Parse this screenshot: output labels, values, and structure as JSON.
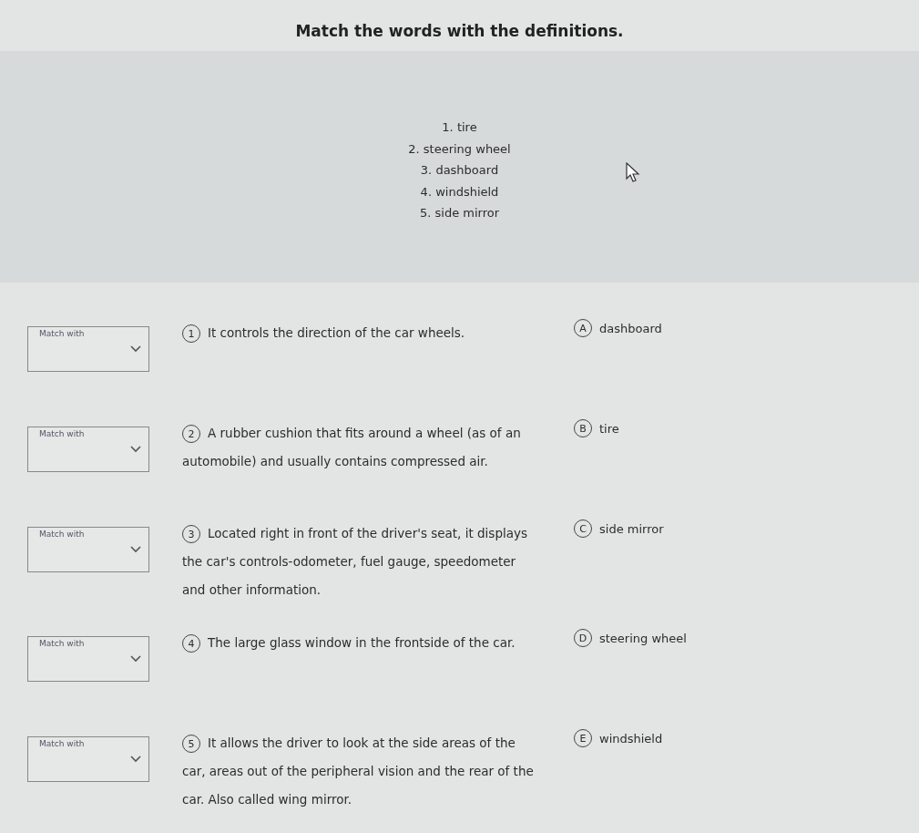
{
  "title": "Match the words with the definitions.",
  "word_list": [
    "1. tire",
    "2. steering wheel",
    "3. dashboard",
    "4. windshield",
    "5. side mirror"
  ],
  "rows": [
    {
      "placeholder": "Match with",
      "number": "1",
      "definition": "It controls the direction of the car wheels.",
      "option_letter": "A",
      "option_word": "dashboard"
    },
    {
      "placeholder": "Match with",
      "number": "2",
      "definition": "A rubber cushion that fits around a wheel (as of an automobile) and usually contains compressed air.",
      "option_letter": "B",
      "option_word": "tire"
    },
    {
      "placeholder": "Match with",
      "number": "3",
      "definition": "Located right in front of the driver's seat, it displays the car's controls-odometer, fuel gauge, speedometer and other information.",
      "option_letter": "C",
      "option_word": "side mirror"
    },
    {
      "placeholder": "Match with",
      "number": "4",
      "definition": "The large glass window in the frontside of the car.",
      "option_letter": "D",
      "option_word": "steering wheel"
    },
    {
      "placeholder": "Match with",
      "number": "5",
      "definition": "It allows the driver to look at the side areas of the car, areas out of the peripheral vision and the rear of the car. Also called wing mirror.",
      "option_letter": "E",
      "option_word": "windshield"
    }
  ]
}
